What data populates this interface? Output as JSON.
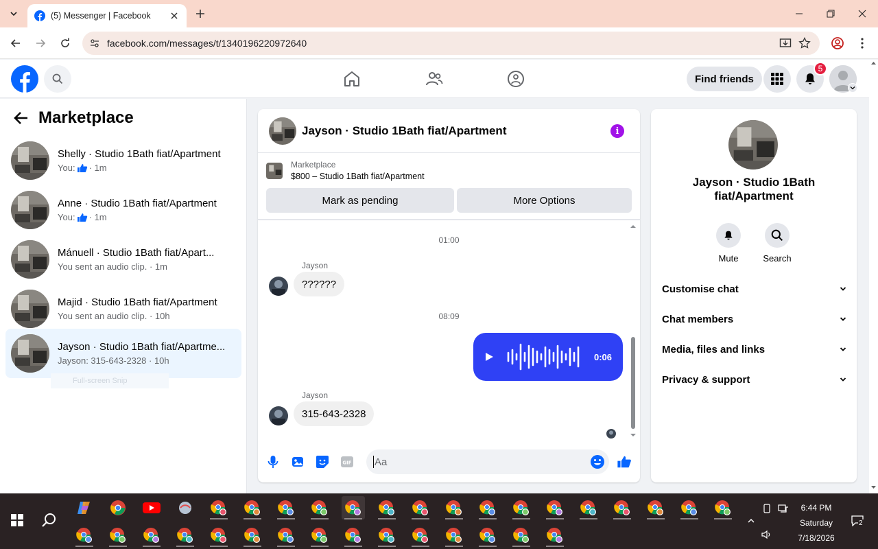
{
  "browser": {
    "tab_title": "(5) Messenger | Facebook",
    "url": "facebook.com/messages/t/1340196220972640"
  },
  "fb": {
    "find_friends_label": "Find friends",
    "notification_count": "5"
  },
  "left": {
    "heading": "Marketplace",
    "conversations": [
      {
        "name": "Shelly · Studio 1Bath fiat/Apartment",
        "prefix": "You:",
        "snippet": "",
        "time": "· 1m",
        "liked": true
      },
      {
        "name": "Anne · Studio 1Bath fiat/Apartment",
        "prefix": "You:",
        "snippet": "",
        "time": "· 1m",
        "liked": true
      },
      {
        "name": "Mánuell · Studio 1Bath fiat/Apart...",
        "prefix": "",
        "snippet": "You sent an audio clip.",
        "time": "· 1m",
        "liked": false
      },
      {
        "name": "Majid · Studio 1Bath fiat/Apartment",
        "prefix": "",
        "snippet": "You sent an audio clip.",
        "time": "· 10h",
        "liked": false
      },
      {
        "name": "Jayson · Studio 1Bath fiat/Apartme...",
        "prefix": "",
        "snippet": "Jayson: 315-643-2328",
        "time": "· 10h",
        "liked": false
      }
    ],
    "ghost_text": "Full-screen Snip"
  },
  "chat": {
    "title": "Jayson · Studio 1Bath fiat/Apartment",
    "info_glyph": "i",
    "marketplace_label": "Marketplace",
    "listing": "$800 – Studio 1Bath fiat/Apartment",
    "mark_pending_label": "Mark as pending",
    "more_options_label": "More Options",
    "time_1": "01:00",
    "sender_1": "Jayson",
    "message_1": "??????",
    "time_2": "08:09",
    "audio_duration": "0:06",
    "sender_2": "Jayson",
    "message_2": "315-643-2328",
    "composer_placeholder": "Aa"
  },
  "right": {
    "name": "Jayson · Studio 1Bath fiat/Apartment",
    "mute_label": "Mute",
    "search_label": "Search",
    "sections": [
      "Customise chat",
      "Chat members",
      "Media, files and links",
      "Privacy & support"
    ]
  },
  "taskbar": {
    "time": "6:44 PM",
    "day": "Saturday",
    "date": "7/18/2026",
    "notification_count": "2"
  },
  "colors": {
    "fb_blue": "#0866ff",
    "audio_bubble": "#2f41f5",
    "info_purple": "#a112e8",
    "badge_red": "#e41e3f",
    "tab_strip": "#f9d8cc"
  }
}
